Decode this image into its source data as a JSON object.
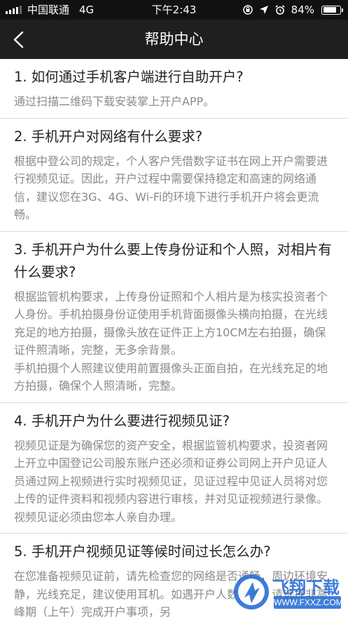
{
  "status_bar": {
    "carrier": "中国联通",
    "network": "4G",
    "time": "下午2:43",
    "battery": "84%",
    "battery_level": 0.84
  },
  "nav": {
    "back_icon": "chevron-left-icon",
    "title": "帮助中心"
  },
  "faqs": [
    {
      "question": "1. 如何通过手机客户端进行自助开户?",
      "answer": [
        "通过扫描二维码下载安装掌上开户APP。"
      ]
    },
    {
      "question": "2. 手机开户对网络有什么要求?",
      "answer": [
        "根据中登公司的规定，个人客户凭借数字证书在网上开户需要进行视频见证。因此，开户过程中需要保持稳定和高速的网络通信，建议您在3G、4G、Wi-Fi的环境下进行手机开户将会更流畅。"
      ]
    },
    {
      "question": "3. 手机开户为什么要上传身份证和个人照，对相片有什么要求?",
      "answer": [
        "根据监管机构要求，上传身份证照和个人相片是为核实投资者个人身份。手机拍摄身份证使用手机背面摄像头横向拍摄，在光线充足的地方拍摄，摄像头放在证件正上方10CM左右拍摄，确保证件照清晰，完整，无多余背景。",
        "手机拍摄个人照建议使用前置摄像头正面自拍，在光线充足的地方拍摄，确保个人照清晰，完整。"
      ]
    },
    {
      "question": "4. 手机开户为什么要进行视频见证?",
      "answer": [
        "视频见证是为确保您的资产安全，根据监管机构要求，投资者网上开立中国登记公司股东账户还必须和证券公司网上开户见证人员通过网上视频进行实时视频见证，见证过程中见证人员将对您上传的证件资料和视频内容进行审核，并对见证视频进行录像。视频见证必须由您本人亲自办理。"
      ]
    },
    {
      "question": "5. 手机开户视频见证等候时间过长怎么办?",
      "answer": [
        "在您准备视频见证前，请先检查您的网络是否通畅，周边环境安静，光线充足，建议使用耳机。如遇开户人数过多，请选择非高峰期（上午）完成开户事项，另"
      ]
    }
  ],
  "watermark": {
    "brand": "飞翔下载",
    "url": "WWW.FXXZ.COM",
    "color": "#2a6fd6"
  }
}
